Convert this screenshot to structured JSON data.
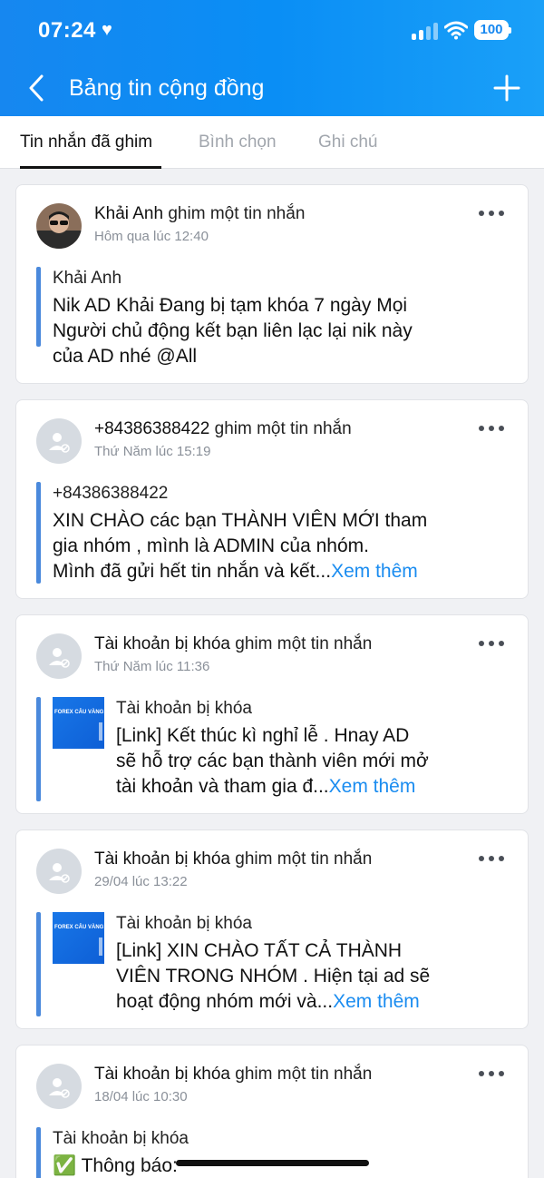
{
  "status_bar": {
    "time": "07:24",
    "battery": "100"
  },
  "header": {
    "title": "Bảng tin cộng đồng"
  },
  "tabs": [
    {
      "label": "Tin nhắn đã ghim"
    },
    {
      "label": "Bình chọn"
    },
    {
      "label": "Ghi chú"
    }
  ],
  "posts": [
    {
      "author": "Khải Anh",
      "action": "ghim một tin nhắn",
      "time": "Hôm qua lúc 12:40",
      "quote_sender": "Khải Anh",
      "text_lines": [
        "Nik AD Khải Đang bị tạm khóa 7 ngày Mọi",
        "Người chủ động kết bạn liên lạc lại nik này",
        "của AD nhé @All"
      ]
    },
    {
      "author": "+84386388422",
      "action": "ghim một tin nhắn",
      "time": "Thứ Năm lúc 15:19",
      "quote_sender": "+84386388422",
      "text_lines": [
        "XIN CHÀO các bạn THÀNH VIÊN MỚI tham",
        "gia nhóm , mình là ADMIN của nhóm.",
        "Mình đã gửi hết tin nhắn và kết..."
      ],
      "see_more": "Xem thêm"
    },
    {
      "author": "Tài khoản bị khóa",
      "action": "ghim một tin nhắn",
      "time": "Thứ Năm lúc 11:36",
      "quote_sender": "Tài khoản bị khóa",
      "thumb_text": "FOREX CÂU VÀNG",
      "text_lines": [
        "[Link] Kết thúc kì nghỉ lễ . Hnay AD",
        "sẽ hỗ trợ các bạn thành viên mới mở",
        "tài khoản và tham gia đ..."
      ],
      "see_more": "Xem thêm"
    },
    {
      "author": "Tài khoản bị khóa",
      "action": "ghim một tin nhắn",
      "time": "29/04 lúc 13:22",
      "quote_sender": "Tài khoản bị khóa",
      "thumb_text": "FOREX CÂU VÀNG",
      "text_lines": [
        "[Link] XIN CHÀO TẤT CẢ THÀNH",
        "VIÊN TRONG NHÓM . Hiện tại ad sẽ",
        "hoạt động nhóm mới và..."
      ],
      "see_more": "Xem thêm"
    },
    {
      "author": "Tài khoản bị khóa",
      "action": "ghim một tin nhắn",
      "time": "18/04 lúc 10:30",
      "quote_sender": "Tài khoản bị khóa",
      "text_lines": [
        "✅ Thông báo:"
      ]
    }
  ],
  "colors": {
    "header": "#1687f0",
    "link": "#1a8cf0",
    "quote_bar": "#4a89dc"
  }
}
